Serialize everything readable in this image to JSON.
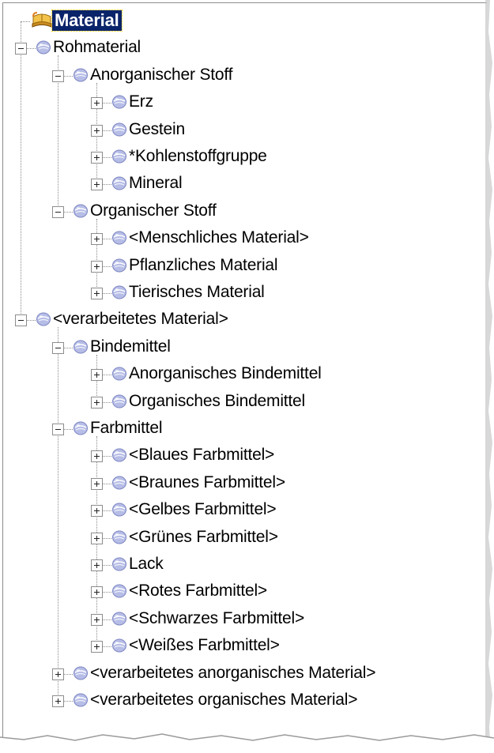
{
  "tree": {
    "root": {
      "label": "Material",
      "icon": "book-icon"
    },
    "nodes": [
      {
        "label": "Rohmaterial",
        "level": 0,
        "state": "expanded",
        "icon": "gem-icon"
      },
      {
        "label": "Anorganischer Stoff",
        "level": 1,
        "state": "expanded",
        "icon": "gem-icon"
      },
      {
        "label": "Erz",
        "level": 2,
        "state": "collapsed",
        "icon": "gem-icon"
      },
      {
        "label": "Gestein",
        "level": 2,
        "state": "collapsed",
        "icon": "gem-icon"
      },
      {
        "label": "*Kohlenstoffgruppe",
        "level": 2,
        "state": "collapsed",
        "icon": "gem-icon"
      },
      {
        "label": "Mineral",
        "level": 2,
        "state": "collapsed",
        "icon": "gem-icon"
      },
      {
        "label": "Organischer Stoff",
        "level": 1,
        "state": "expanded",
        "icon": "gem-icon"
      },
      {
        "label": "<Menschliches Material>",
        "level": 2,
        "state": "collapsed",
        "icon": "gem-icon"
      },
      {
        "label": "Pflanzliches Material",
        "level": 2,
        "state": "collapsed",
        "icon": "gem-icon"
      },
      {
        "label": "Tierisches Material",
        "level": 2,
        "state": "collapsed",
        "icon": "gem-icon"
      },
      {
        "label": "<verarbeitetes Material>",
        "level": 0,
        "state": "expanded",
        "icon": "gem-icon"
      },
      {
        "label": "Bindemittel",
        "level": 1,
        "state": "expanded",
        "icon": "gem-icon"
      },
      {
        "label": "Anorganisches Bindemittel",
        "level": 2,
        "state": "collapsed",
        "icon": "gem-icon"
      },
      {
        "label": "Organisches Bindemittel",
        "level": 2,
        "state": "collapsed",
        "icon": "gem-icon"
      },
      {
        "label": "Farbmittel",
        "level": 1,
        "state": "expanded",
        "icon": "gem-icon"
      },
      {
        "label": "<Blaues Farbmittel>",
        "level": 2,
        "state": "collapsed",
        "icon": "gem-icon"
      },
      {
        "label": "<Braunes Farbmittel>",
        "level": 2,
        "state": "collapsed",
        "icon": "gem-icon"
      },
      {
        "label": "<Gelbes Farbmittel>",
        "level": 2,
        "state": "collapsed",
        "icon": "gem-icon"
      },
      {
        "label": "<Grünes Farbmittel>",
        "level": 2,
        "state": "collapsed",
        "icon": "gem-icon"
      },
      {
        "label": "Lack",
        "level": 2,
        "state": "collapsed",
        "icon": "gem-icon"
      },
      {
        "label": "<Rotes Farbmittel>",
        "level": 2,
        "state": "collapsed",
        "icon": "gem-icon"
      },
      {
        "label": "<Schwarzes Farbmittel>",
        "level": 2,
        "state": "collapsed",
        "icon": "gem-icon"
      },
      {
        "label": "<Weißes Farbmittel>",
        "level": 2,
        "state": "collapsed",
        "icon": "gem-icon"
      },
      {
        "label": "<verarbeitetes anorganisches Material>",
        "level": 1,
        "state": "collapsed",
        "icon": "gem-icon"
      },
      {
        "label": "<verarbeitetes organisches Material>",
        "level": 1,
        "state": "collapsed",
        "icon": "gem-icon"
      }
    ]
  },
  "colors": {
    "selection_bg": "#0a246a",
    "selection_text": "#ffffff",
    "node_icon": "#a9b3e0",
    "root_icon": "#e0a030"
  }
}
